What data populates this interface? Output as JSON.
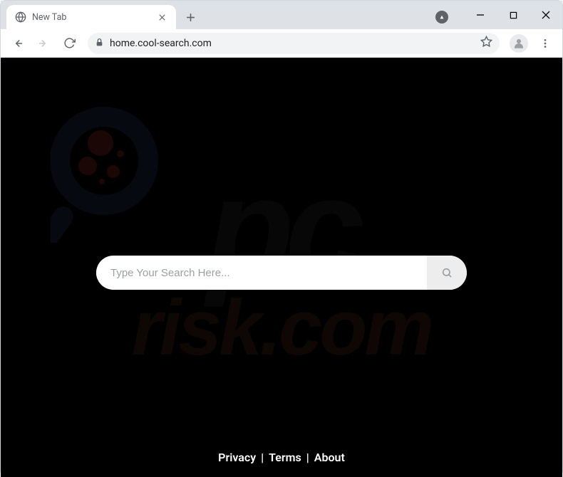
{
  "window": {
    "tab_title": "New Tab",
    "url": "home.cool-search.com"
  },
  "search": {
    "placeholder": "Type Your Search Here...",
    "value": ""
  },
  "footer": {
    "links": [
      "Privacy",
      "Terms",
      "About"
    ],
    "separator": "|"
  },
  "watermark": {
    "line1": "pc",
    "line2": "risk.com"
  }
}
